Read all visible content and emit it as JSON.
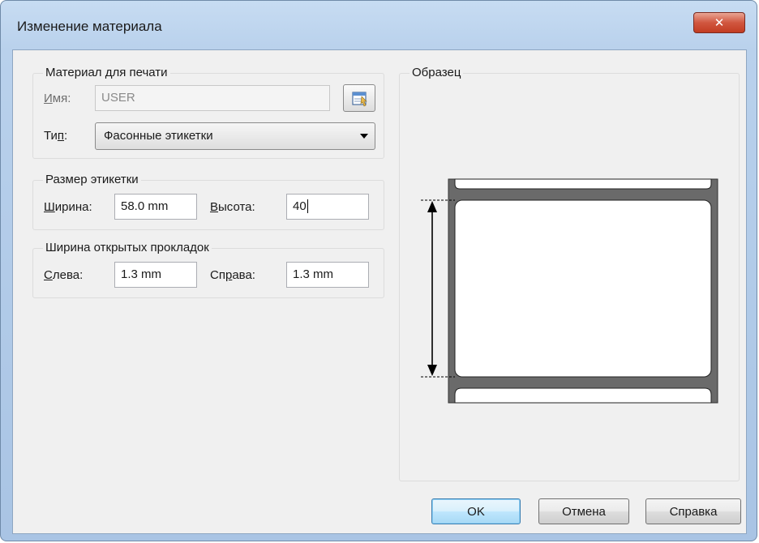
{
  "window": {
    "title": "Изменение материала"
  },
  "material": {
    "group_label": "Материал для печати",
    "name_label_u": "И",
    "name_label_rest": "мя:",
    "name_value": "USER",
    "type_label_a": "Ти",
    "type_label_u": "п",
    "type_label_rest": ":",
    "type_value": "Фасонные этикетки"
  },
  "label_size": {
    "group_label": "Размер этикетки",
    "width_label_u": "Ш",
    "width_label_rest": "ирина:",
    "width_value": "58.0 mm",
    "height_label_u": "В",
    "height_label_rest": "ысота:",
    "height_value": "40"
  },
  "gap_width": {
    "group_label": "Ширина открытых прокладок",
    "left_label_u": "С",
    "left_label_rest": "лева:",
    "left_value": "1.3 mm",
    "right_label_a": "Сп",
    "right_label_u": "р",
    "right_label_rest": "ава:",
    "right_value": "1.3 mm"
  },
  "preview": {
    "group_label": "Образец"
  },
  "buttons": {
    "ok": "OK",
    "cancel": "Отмена",
    "help": "Справка"
  },
  "icons": {
    "close": "close-icon",
    "properties": "properties-icon",
    "dropdown": "chevron-down-icon"
  }
}
